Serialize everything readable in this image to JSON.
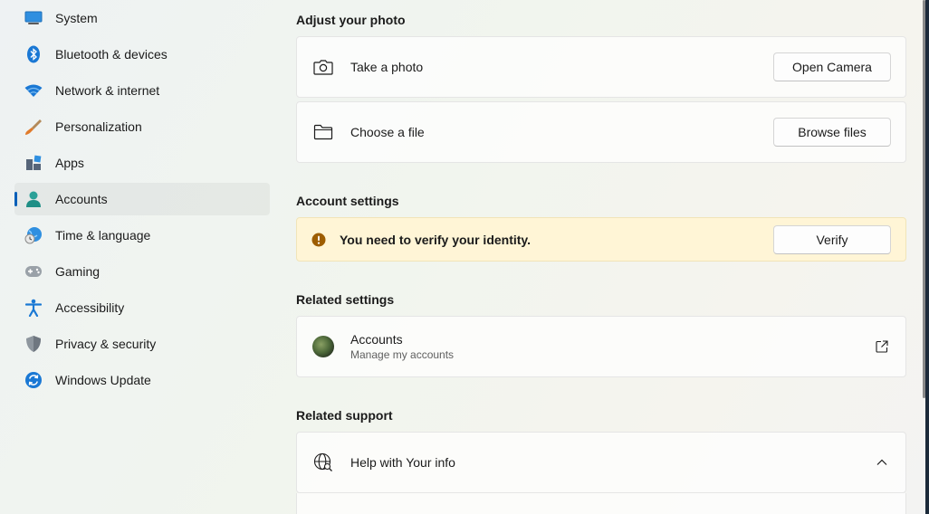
{
  "sidebar": {
    "items": [
      {
        "label": "System",
        "icon": "system-icon"
      },
      {
        "label": "Bluetooth & devices",
        "icon": "bluetooth-icon"
      },
      {
        "label": "Network & internet",
        "icon": "wifi-icon"
      },
      {
        "label": "Personalization",
        "icon": "brush-icon"
      },
      {
        "label": "Apps",
        "icon": "apps-icon"
      },
      {
        "label": "Accounts",
        "icon": "accounts-icon",
        "active": true
      },
      {
        "label": "Time & language",
        "icon": "globe-clock-icon"
      },
      {
        "label": "Gaming",
        "icon": "gamepad-icon"
      },
      {
        "label": "Accessibility",
        "icon": "accessibility-icon"
      },
      {
        "label": "Privacy & security",
        "icon": "shield-icon"
      },
      {
        "label": "Windows Update",
        "icon": "update-icon"
      }
    ]
  },
  "main": {
    "adjust_photo": {
      "title": "Adjust your photo",
      "take_photo": {
        "label": "Take a photo",
        "button": "Open Camera",
        "icon": "camera-icon"
      },
      "choose_file": {
        "label": "Choose a file",
        "button": "Browse files",
        "icon": "folder-icon"
      }
    },
    "account_settings": {
      "title": "Account settings",
      "warning": {
        "text": "You need to verify your identity.",
        "button": "Verify",
        "icon": "warning-icon"
      }
    },
    "related_settings": {
      "title": "Related settings",
      "accounts": {
        "label": "Accounts",
        "sub": "Manage my accounts",
        "icon": "external-link-icon"
      }
    },
    "related_support": {
      "title": "Related support",
      "help": {
        "label": "Help with Your info",
        "icon": "web-search-icon",
        "toggle_icon": "chevron-up-icon"
      }
    }
  },
  "colors": {
    "accent": "#005fb8",
    "warning": "#9d5d00",
    "warning_bg": "#fff5d6"
  }
}
